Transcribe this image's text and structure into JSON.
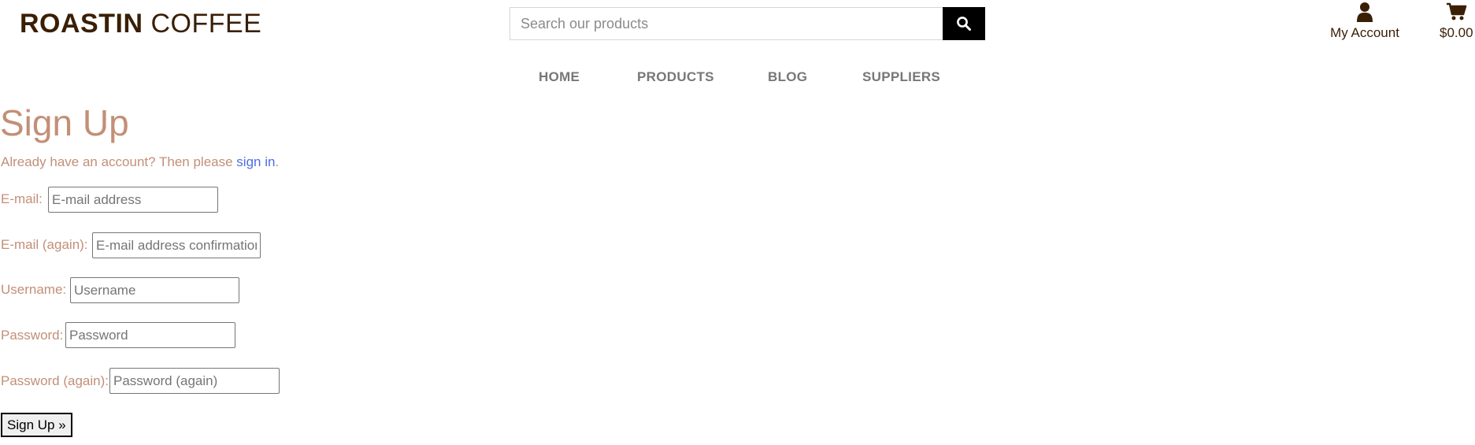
{
  "header": {
    "logo_bold": "ROASTIN",
    "logo_thin": " COFFEE",
    "search": {
      "placeholder": "Search our products",
      "value": ""
    },
    "account_label": "My Account",
    "cart_total": "$0.00"
  },
  "nav": {
    "items": [
      {
        "label": "HOME"
      },
      {
        "label": "PRODUCTS"
      },
      {
        "label": "BLOG"
      },
      {
        "label": "SUPPLIERS"
      }
    ]
  },
  "main": {
    "title": "Sign Up",
    "intro_text": "Already have an account? Then please ",
    "intro_link": "sign in",
    "intro_end": ".",
    "fields": [
      {
        "label": "E-mail:",
        "placeholder": "E-mail address"
      },
      {
        "label": "E-mail (again):",
        "placeholder": "E-mail address confirmation"
      },
      {
        "label": "Username:",
        "placeholder": "Username"
      },
      {
        "label": "Password:",
        "placeholder": "Password"
      },
      {
        "label": "Password (again):",
        "placeholder": "Password (again)"
      }
    ],
    "submit_label": "Sign Up »"
  },
  "colors": {
    "brand_dark": "#3a1f05",
    "accent_tan": "#c38f77",
    "link_blue": "#4d6ce6",
    "nav_gray": "#777777"
  },
  "icons": {
    "search": "search-icon",
    "account": "user-icon",
    "cart": "cart-icon"
  }
}
